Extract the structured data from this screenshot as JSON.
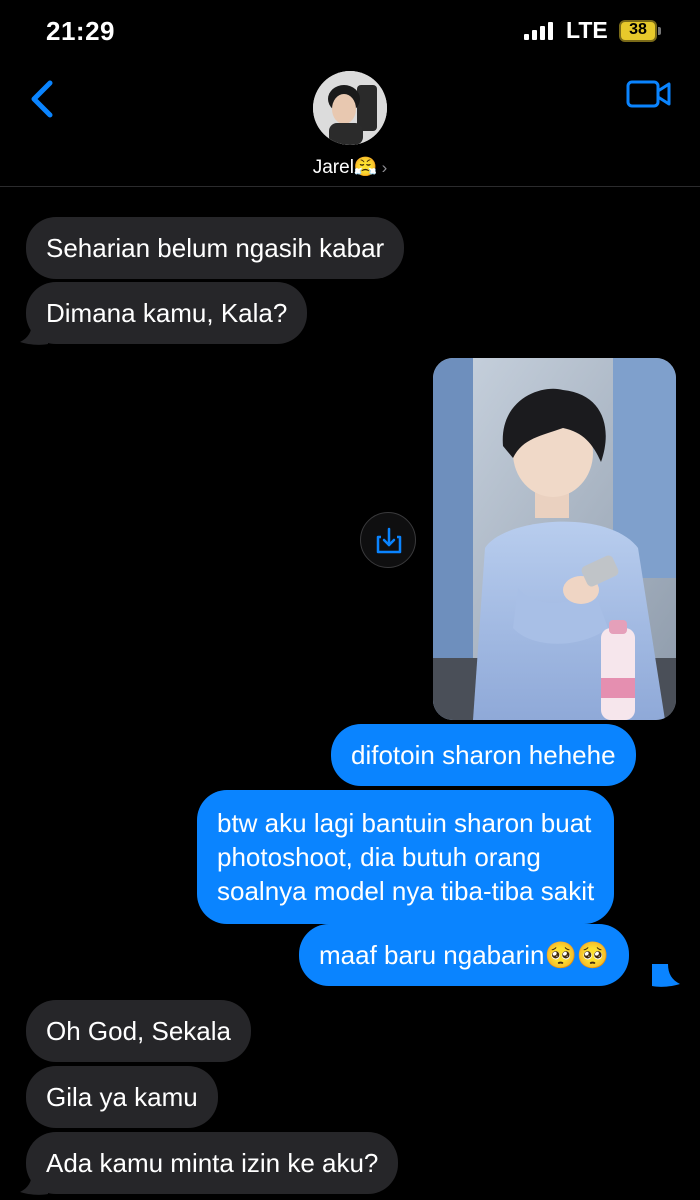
{
  "status_bar": {
    "time": "21:29",
    "network": "LTE",
    "battery": "38"
  },
  "header": {
    "contact_name": "Jarel😤",
    "chevron": "›"
  },
  "messages": {
    "m1": "Seharian belum ngasih kabar",
    "m2": "Dimana kamu, Kala?",
    "m3": "difotoin sharon hehehe",
    "m4_line1": "btw aku lagi bantuin sharon buat",
    "m4_line2": "photoshoot, dia butuh orang",
    "m4_line3": "soalnya model nya tiba-tiba sakit",
    "m5": "maaf baru ngabarin🥺🥺",
    "m6": "Oh God, Sekala",
    "m7": "Gila ya kamu",
    "m8": "Ada kamu minta izin ke aku?"
  },
  "icons": {
    "back": "chevron-left-icon",
    "video": "video-camera-icon",
    "share": "share-download-icon"
  },
  "colors": {
    "background": "#000000",
    "sent_bubble": "#0a84ff",
    "received_bubble": "#262629",
    "accent": "#0a84ff"
  }
}
